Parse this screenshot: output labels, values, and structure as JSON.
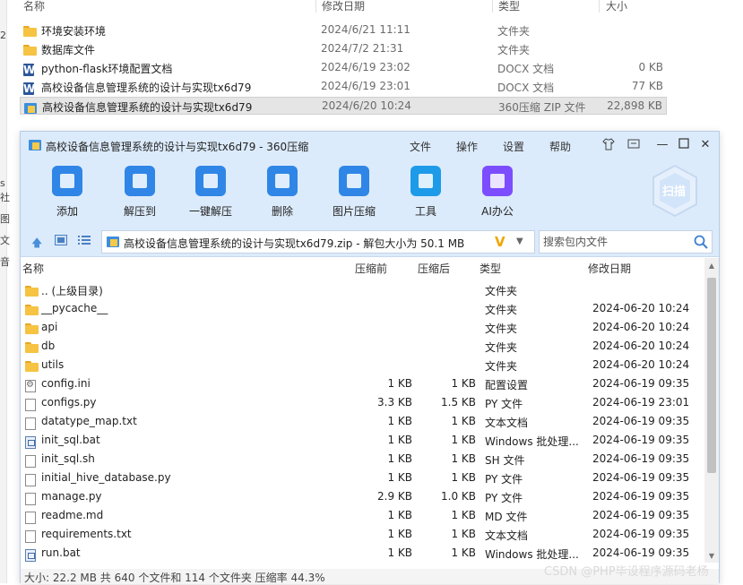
{
  "explorer": {
    "columns": {
      "name": "名称",
      "date": "修改日期",
      "type": "类型",
      "size": "大小"
    },
    "left_strip": [
      "2",
      "s",
      "社",
      "图",
      "文",
      "音"
    ],
    "rows": [
      {
        "icon": "folder-icon",
        "name": "环境安装环境",
        "date": "2024/6/21 11:11",
        "type": "文件夹",
        "size": ""
      },
      {
        "icon": "folder-icon",
        "name": "数据库文件",
        "date": "2024/7/2 21:31",
        "type": "文件夹",
        "size": ""
      },
      {
        "icon": "docx-icon",
        "name": "python-flask环境配置文档",
        "date": "2024/6/19 23:02",
        "type": "DOCX 文档",
        "size": "0 KB"
      },
      {
        "icon": "docx-icon",
        "name": "高校设备信息管理系统的设计与实现tx6d79",
        "date": "2024/6/19 23:01",
        "type": "DOCX 文档",
        "size": "77 KB"
      },
      {
        "icon": "zip-icon",
        "name": "高校设备信息管理系统的设计与实现tx6d79",
        "date": "2024/6/20 10:24",
        "type": "360压缩 ZIP 文件",
        "size": "22,898 KB",
        "selected": true
      }
    ]
  },
  "window": {
    "title": "高校设备信息管理系统的设计与实现tx6d79 - 360压缩",
    "menu": [
      "文件",
      "操作",
      "设置",
      "帮助"
    ],
    "toolbar": [
      {
        "label": "添加",
        "icon": "add-icon",
        "color": "#2f86e6"
      },
      {
        "label": "解压到",
        "icon": "extract-to-icon",
        "color": "#2f86e6"
      },
      {
        "label": "一键解压",
        "icon": "one-click-extract-icon",
        "color": "#2f86e6"
      },
      {
        "label": "删除",
        "icon": "delete-icon",
        "color": "#2f86e6"
      },
      {
        "label": "图片压缩",
        "icon": "image-compress-icon",
        "color": "#2f86e6"
      },
      {
        "label": "工具",
        "icon": "tools-icon",
        "color": "#1e9be8"
      },
      {
        "label": "AI办公",
        "icon": "ai-office-icon",
        "color": "#7c4dff"
      }
    ],
    "scan_label": "扫描",
    "path": "高校设备信息管理系统的设计与实现tx6d79.zip - 解包大小为 50.1 MB",
    "search_placeholder": "搜索包内文件",
    "columns": {
      "name": "名称",
      "before": "压缩前",
      "after": "压缩后",
      "type": "类型",
      "date": "修改日期"
    },
    "files": [
      {
        "icon": "folder-icon",
        "name": ".. (上级目录)",
        "before": "",
        "after": "",
        "type": "文件夹",
        "date": ""
      },
      {
        "icon": "folder-icon",
        "name": "__pycache__",
        "before": "",
        "after": "",
        "type": "文件夹",
        "date": "2024-06-20 10:24"
      },
      {
        "icon": "folder-icon",
        "name": "api",
        "before": "",
        "after": "",
        "type": "文件夹",
        "date": "2024-06-20 10:24"
      },
      {
        "icon": "folder-icon",
        "name": "db",
        "before": "",
        "after": "",
        "type": "文件夹",
        "date": "2024-06-20 10:24"
      },
      {
        "icon": "folder-icon",
        "name": "utils",
        "before": "",
        "after": "",
        "type": "文件夹",
        "date": "2024-06-20 10:24"
      },
      {
        "icon": "config-file-icon",
        "name": "config.ini",
        "before": "1 KB",
        "after": "1 KB",
        "type": "配置设置",
        "date": "2024-06-19 09:35"
      },
      {
        "icon": "file-icon",
        "name": "configs.py",
        "before": "3.3 KB",
        "after": "1.5 KB",
        "type": "PY 文件",
        "date": "2024-06-19 23:01"
      },
      {
        "icon": "file-icon",
        "name": "datatype_map.txt",
        "before": "1 KB",
        "after": "1 KB",
        "type": "文本文档",
        "date": "2024-06-19 09:35"
      },
      {
        "icon": "bat-file-icon",
        "name": "init_sql.bat",
        "before": "1 KB",
        "after": "1 KB",
        "type": "Windows 批处理...",
        "date": "2024-06-19 09:35"
      },
      {
        "icon": "file-icon",
        "name": "init_sql.sh",
        "before": "1 KB",
        "after": "1 KB",
        "type": "SH 文件",
        "date": "2024-06-19 09:35"
      },
      {
        "icon": "file-icon",
        "name": "initial_hive_database.py",
        "before": "1 KB",
        "after": "1 KB",
        "type": "PY 文件",
        "date": "2024-06-19 09:35"
      },
      {
        "icon": "file-icon",
        "name": "manage.py",
        "before": "2.9 KB",
        "after": "1.0 KB",
        "type": "PY 文件",
        "date": "2024-06-19 09:35"
      },
      {
        "icon": "file-icon",
        "name": "readme.md",
        "before": "1 KB",
        "after": "1 KB",
        "type": "MD 文件",
        "date": "2024-06-19 09:35"
      },
      {
        "icon": "file-icon",
        "name": "requirements.txt",
        "before": "1 KB",
        "after": "1 KB",
        "type": "文本文档",
        "date": "2024-06-19 09:35"
      },
      {
        "icon": "bat-file-icon",
        "name": "run.bat",
        "before": "1 KB",
        "after": "1 KB",
        "type": "Windows 批处理...",
        "date": "2024-06-19 09:35"
      }
    ],
    "status": "大小: 22.2 MB 共 640 个文件和 114 个文件夹 压缩率 44.3%"
  },
  "watermark": "CSDN @PHP毕设程序源码老杨"
}
